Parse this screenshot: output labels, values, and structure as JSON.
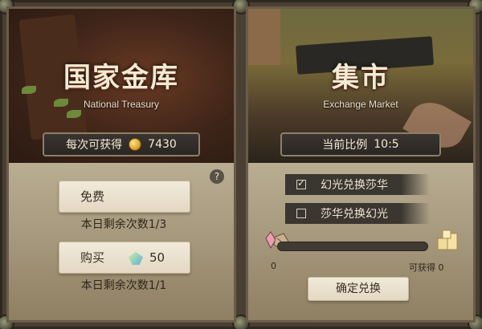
{
  "treasury": {
    "title": "国家金库",
    "subtitle": "National Treasury",
    "per_time_label": "每次可获得",
    "per_time_value": "7430",
    "free_label": "免费",
    "free_note": "本日剩余次数1/3",
    "buy_label": "购买",
    "buy_cost": "50",
    "buy_note": "本日剩余次数1/1",
    "help": "?"
  },
  "market": {
    "title": "集市",
    "subtitle": "Exchange Market",
    "ratio_label": "当前比例",
    "ratio_value": "10:5",
    "option1": "幻光兑换莎华",
    "option2": "莎华兑换幻光",
    "slider_value": "0",
    "obtainable": "可获得 0",
    "slider_fraction": 0,
    "confirm_label": "确定兑换"
  },
  "icons": {
    "coin": "gold-coin-icon",
    "gem": "gem-icon",
    "help": "help-icon",
    "checkbox_checked": "checkbox-checked-icon",
    "checkbox_unchecked": "checkbox-unchecked-icon",
    "crystal": "crystal-icon",
    "gold_bars": "gold-bars-icon"
  }
}
